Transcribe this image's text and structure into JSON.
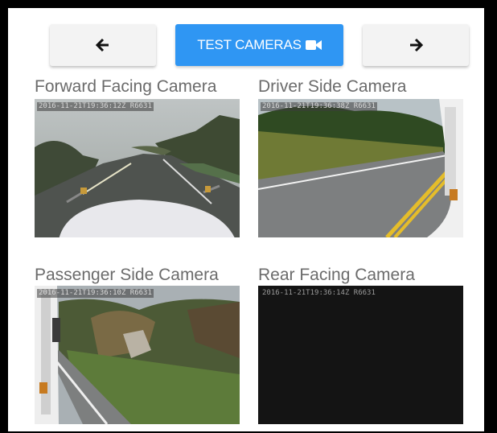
{
  "toolbar": {
    "prev_icon": "arrow-left-icon",
    "test_label": "TEST CAMERAS",
    "test_icon": "video-camera-icon",
    "next_icon": "arrow-right-icon",
    "accent": "#2f96f3"
  },
  "cameras": [
    {
      "title": "Forward Facing Camera",
      "timestamp": "2016-11-21T19:36:12Z  R6631"
    },
    {
      "title": "Driver Side Camera",
      "timestamp": "2016-11-21T19:36:38Z  R6631"
    },
    {
      "title": "Passenger Side Camera",
      "timestamp": "2016-11-21T19:36:10Z  R6631"
    },
    {
      "title": "Rear Facing Camera",
      "timestamp": "2016-11-21T19:36:14Z  R6631"
    }
  ]
}
